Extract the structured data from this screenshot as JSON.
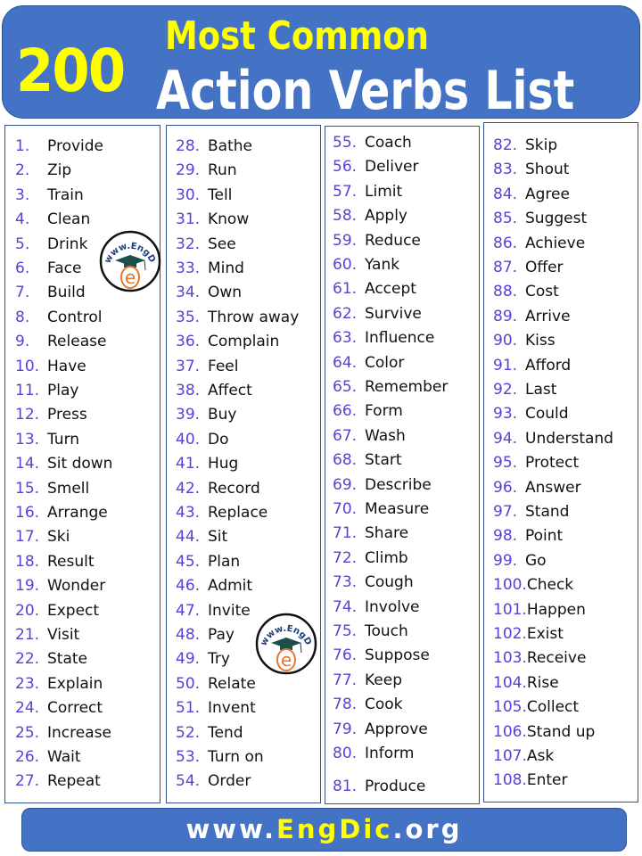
{
  "header": {
    "count": "200",
    "subtitle": "Most Common",
    "title": "Action Verbs List"
  },
  "columns": [
    {
      "items": [
        {
          "num": "1.",
          "verb": "Provide"
        },
        {
          "num": "2.",
          "verb": "Zip"
        },
        {
          "num": "3.",
          "verb": "Train"
        },
        {
          "num": "4.",
          "verb": "Clean"
        },
        {
          "num": "5.",
          "verb": "Drink"
        },
        {
          "num": "6.",
          "verb": "Face"
        },
        {
          "num": "7.",
          "verb": "Build"
        },
        {
          "num": "8.",
          "verb": "Control"
        },
        {
          "num": "9.",
          "verb": "Release"
        },
        {
          "num": "10.",
          "verb": "Have"
        },
        {
          "num": "11.",
          "verb": "Play"
        },
        {
          "num": "12.",
          "verb": "Press"
        },
        {
          "num": "13.",
          "verb": "Turn"
        },
        {
          "num": "14.",
          "verb": "Sit down"
        },
        {
          "num": "15.",
          "verb": "Smell"
        },
        {
          "num": "16.",
          "verb": "Arrange"
        },
        {
          "num": "17.",
          "verb": "Ski"
        },
        {
          "num": "18.",
          "verb": "Result"
        },
        {
          "num": "19.",
          "verb": "Wonder"
        },
        {
          "num": "20.",
          "verb": "Expect"
        },
        {
          "num": "21.",
          "verb": "Visit"
        },
        {
          "num": "22.",
          "verb": "State"
        },
        {
          "num": "23.",
          "verb": "Explain"
        },
        {
          "num": "24.",
          "verb": "Correct"
        },
        {
          "num": "25.",
          "verb": "Increase"
        },
        {
          "num": "26.",
          "verb": "Wait"
        },
        {
          "num": "27.",
          "verb": "Repeat"
        }
      ]
    },
    {
      "items": [
        {
          "num": "28.",
          "verb": "Bathe"
        },
        {
          "num": "29.",
          "verb": "Run"
        },
        {
          "num": "30.",
          "verb": "Tell"
        },
        {
          "num": "31.",
          "verb": "Know"
        },
        {
          "num": "32.",
          "verb": "See"
        },
        {
          "num": "33.",
          "verb": "Mind"
        },
        {
          "num": "34.",
          "verb": "Own"
        },
        {
          "num": "35.",
          "verb": "Throw away"
        },
        {
          "num": "36.",
          "verb": "Complain"
        },
        {
          "num": "37.",
          "verb": "Feel"
        },
        {
          "num": "38.",
          "verb": "Affect"
        },
        {
          "num": "39.",
          "verb": "Buy"
        },
        {
          "num": "40.",
          "verb": "Do"
        },
        {
          "num": "41.",
          "verb": "Hug"
        },
        {
          "num": "42.",
          "verb": "Record"
        },
        {
          "num": "43.",
          "verb": "Replace"
        },
        {
          "num": "44.",
          "verb": "Sit"
        },
        {
          "num": "45.",
          "verb": "Plan"
        },
        {
          "num": "46.",
          "verb": "Admit"
        },
        {
          "num": "47.",
          "verb": "Invite"
        },
        {
          "num": "48.",
          "verb": "Pay"
        },
        {
          "num": "49.",
          "verb": "Try"
        },
        {
          "num": "50.",
          "verb": "Relate"
        },
        {
          "num": "51.",
          "verb": "Invent"
        },
        {
          "num": "52.",
          "verb": "Tend"
        },
        {
          "num": "53.",
          "verb": "Turn on"
        },
        {
          "num": "54.",
          "verb": "Order"
        }
      ]
    },
    {
      "items": [
        {
          "num": "55.",
          "verb": "Coach"
        },
        {
          "num": "56.",
          "verb": "Deliver"
        },
        {
          "num": "57.",
          "verb": "Limit"
        },
        {
          "num": "58.",
          "verb": "Apply"
        },
        {
          "num": "59.",
          "verb": "Reduce"
        },
        {
          "num": "60.",
          "verb": "Yank"
        },
        {
          "num": "61.",
          "verb": "Accept"
        },
        {
          "num": "62.",
          "verb": "Survive"
        },
        {
          "num": "63.",
          "verb": "Influence"
        },
        {
          "num": "64.",
          "verb": "Color"
        },
        {
          "num": "65.",
          "verb": "Remember"
        },
        {
          "num": "66.",
          "verb": "Form"
        },
        {
          "num": "67.",
          "verb": "Wash"
        },
        {
          "num": "68.",
          "verb": "Start"
        },
        {
          "num": "69.",
          "verb": "Describe"
        },
        {
          "num": "70.",
          "verb": "Measure"
        },
        {
          "num": "71.",
          "verb": "Share"
        },
        {
          "num": "72.",
          "verb": "Climb"
        },
        {
          "num": "73.",
          "verb": "Cough"
        },
        {
          "num": "74.",
          "verb": "Involve"
        },
        {
          "num": "75.",
          "verb": "Touch"
        },
        {
          "num": "76.",
          "verb": "Suppose"
        },
        {
          "num": "77.",
          "verb": "Keep"
        },
        {
          "num": "78.",
          "verb": "Cook"
        },
        {
          "num": "79.",
          "verb": "Approve"
        },
        {
          "num": "80.",
          "verb": "Inform"
        },
        {
          "num": "81.",
          "verb": "Produce"
        }
      ]
    },
    {
      "items": [
        {
          "num": "82.",
          "verb": "Skip"
        },
        {
          "num": "83.",
          "verb": "Shout"
        },
        {
          "num": "84.",
          "verb": "Agree"
        },
        {
          "num": "85.",
          "verb": "Suggest"
        },
        {
          "num": "86.",
          "verb": "Achieve"
        },
        {
          "num": "87.",
          "verb": "Offer"
        },
        {
          "num": "88.",
          "verb": "Cost"
        },
        {
          "num": "89.",
          "verb": "Arrive"
        },
        {
          "num": "90.",
          "verb": "Kiss"
        },
        {
          "num": "91.",
          "verb": "Afford"
        },
        {
          "num": "92.",
          "verb": "Last"
        },
        {
          "num": "93.",
          "verb": "Could"
        },
        {
          "num": "94.",
          "verb": "Understand"
        },
        {
          "num": "95.",
          "verb": "Protect"
        },
        {
          "num": "96.",
          "verb": "Answer"
        },
        {
          "num": "97.",
          "verb": "Stand"
        },
        {
          "num": "98.",
          "verb": "Point"
        },
        {
          "num": "99.",
          "verb": "Go"
        },
        {
          "num": "100.",
          "verb": "Check"
        },
        {
          "num": "101.",
          "verb": "Happen"
        },
        {
          "num": "102.",
          "verb": "Exist"
        },
        {
          "num": "103.",
          "verb": "Receive"
        },
        {
          "num": "104.",
          "verb": "Rise"
        },
        {
          "num": "105.",
          "verb": "Collect"
        },
        {
          "num": "106.",
          "verb": "Stand up"
        },
        {
          "num": "107.",
          "verb": "Ask"
        },
        {
          "num": "108.",
          "verb": "Enter"
        }
      ]
    }
  ],
  "watermark": {
    "text_top": "www.EngDic.org",
    "letter": "e"
  },
  "footer": {
    "prefix": "www.",
    "brand": "EngDic",
    "suffix": ".org"
  },
  "colors": {
    "header_bg": "#4472C4",
    "accent_yellow": "#FFFF00",
    "number_color": "#5B3FD6",
    "logo_orange": "#E8772E"
  }
}
